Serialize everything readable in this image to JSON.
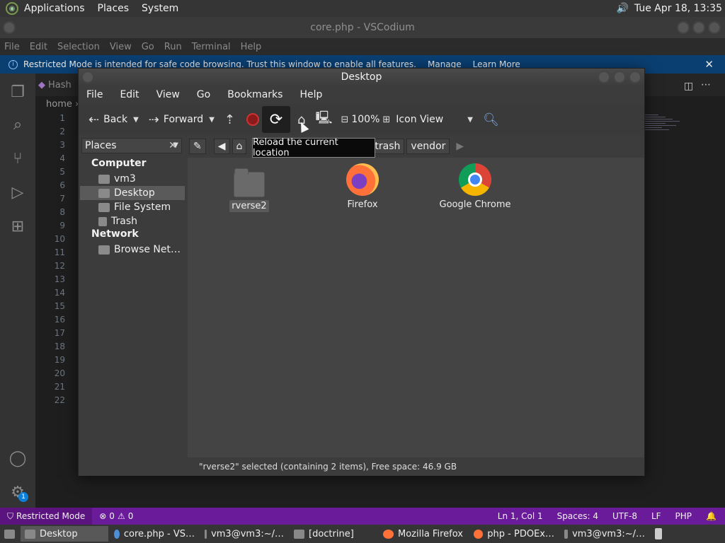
{
  "top_panel": {
    "menus": [
      "Applications",
      "Places",
      "System"
    ],
    "clock": "Tue Apr 18, 13:35"
  },
  "vscodium": {
    "title": "core.php - VSCodium",
    "menus": [
      "File",
      "Edit",
      "Selection",
      "View",
      "Go",
      "Run",
      "Terminal",
      "Help"
    ],
    "banner": {
      "text": "Restricted Mode is intended for safe code browsing. Trust this window to enable all features.",
      "manage": "Manage",
      "learn_more": "Learn More"
    },
    "tab_label": "Hash",
    "breadcrumb": "home",
    "line_numbers": [
      "1",
      "2",
      "3",
      "4",
      "5",
      "6",
      "7",
      "8",
      "9",
      "10",
      "11",
      "12",
      "13",
      "14",
      "15",
      "16",
      "17",
      "18",
      "19",
      "20",
      "21",
      "22"
    ],
    "status": {
      "mode": "Restricted Mode",
      "errors": "0",
      "warnings": "0",
      "position": "Ln 1, Col 1",
      "spaces": "Spaces: 4",
      "encoding": "UTF-8",
      "eol": "LF",
      "language": "PHP"
    },
    "notification_count": "1"
  },
  "caja": {
    "title": "Desktop",
    "menus": [
      "File",
      "Edit",
      "View",
      "Go",
      "Bookmarks",
      "Help"
    ],
    "toolbar": {
      "back": "Back",
      "forward": "Forward",
      "zoom": "100%",
      "view_mode": "Icon View"
    },
    "places_label": "Places",
    "sidebar": {
      "computer_header": "Computer",
      "computer_items": [
        "vm3",
        "Desktop",
        "File System",
        "Trash"
      ],
      "network_header": "Network",
      "network_items": [
        "Browse Net…"
      ]
    },
    "path": [
      "trash",
      "vendor"
    ],
    "files": [
      {
        "name": "rverse2",
        "kind": "folder"
      },
      {
        "name": "Firefox",
        "kind": "firefox"
      },
      {
        "name": "Google Chrome",
        "kind": "chrome"
      }
    ],
    "status_text": "\"rverse2\" selected (containing 2 items), Free space: 46.9 GB",
    "tooltip": "Reload the current location"
  },
  "taskbar": [
    "Desktop",
    "core.php - VS…",
    "vm3@vm3:~/…",
    "[doctrine]",
    "Mozilla Firefox",
    "php - PDOEx…",
    "vm3@vm3:~/…"
  ]
}
